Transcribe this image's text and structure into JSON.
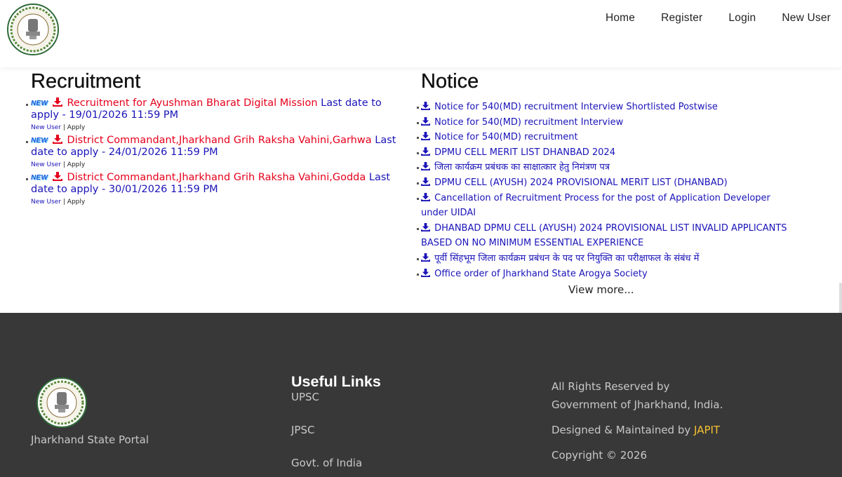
{
  "nav": {
    "items": [
      "Home",
      "Register",
      "Login",
      "New User"
    ]
  },
  "recruitment": {
    "title": "Recruitment",
    "new_badge": "NEW",
    "items": [
      {
        "title": "Recruitment for Ayushman Bharat Digital Mission",
        "date": "Last date to apply - 19/01/2026 11:59 PM",
        "new_user": "New User",
        "apply": "Apply"
      },
      {
        "title": "District Commandant,Jharkhand Grih Raksha Vahini,Garhwa",
        "date": "Last date to apply - 24/01/2026 11:59 PM",
        "new_user": "New User",
        "apply": "Apply"
      },
      {
        "title": "District Commandant,Jharkhand Grih Raksha Vahini,Godda",
        "date": "Last date to apply - 30/01/2026 11:59 PM",
        "new_user": "New User",
        "apply": "Apply"
      }
    ]
  },
  "notice": {
    "title": "Notice",
    "items": [
      "Notice for 540(MD) recruitment Interview Shortlisted Postwise",
      "Notice for 540(MD) recruitment Interview",
      "Notice for 540(MD) recruitment",
      "DPMU CELL MERIT LIST DHANBAD 2024",
      "जिला कार्यक्रम प्रबंधक का साक्षात्कार हेतु निमंत्रण पत्र",
      "DPMU CELL (AYUSH) 2024 PROVISIONAL MERIT LIST (DHANBAD)",
      "Cancellation of Recruitment Process for the post of Application Developer under UIDAI",
      "DHANBAD DPMU CELL (AYUSH) 2024 PROVISIONAL LIST INVALID APPLICANTS BASED ON NO MINIMUM ESSENTIAL EXPERIENCE",
      "पूर्वी सिंहभूम जिला कार्यक्रम प्रबंधन के पद पर नियुक्ति का परीक्षाफल के संबंध में",
      "Office order of Jharkhand State Arogya Society"
    ],
    "view_more": "View more..."
  },
  "footer": {
    "portal_name": "Jharkhand State Portal",
    "useful_links_title": "Useful Links",
    "useful_links": [
      "UPSC",
      "JPSC",
      "Govt. of India"
    ],
    "rights_line1": "All Rights Reserved by",
    "rights_line2": "Government of Jharkhand, India.",
    "designed_by": "Designed & Maintained by",
    "designer": "JAPIT",
    "copyright": "Copyright © 2026"
  },
  "colors": {
    "recruit_title": "#e5001b",
    "link_blue": "#1a13b8",
    "footer_bg": "#383838",
    "japit_accent": "#f7c331"
  }
}
